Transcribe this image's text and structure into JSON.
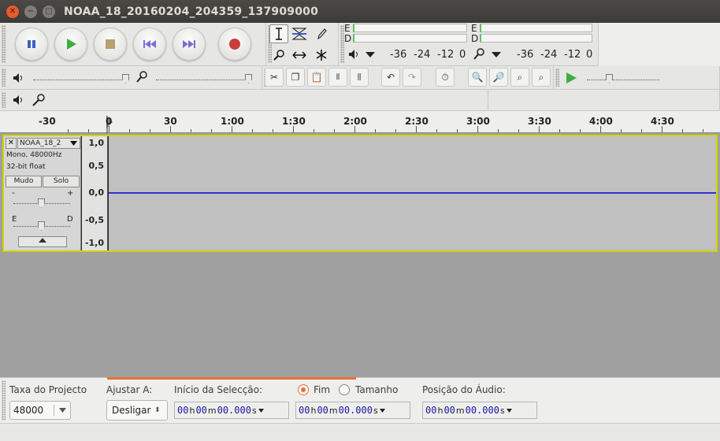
{
  "window": {
    "title": "NOAA_18_20160204_204359_137909000",
    "controls": [
      "close",
      "minimize",
      "maximize"
    ]
  },
  "transport": {
    "buttons": [
      "pause",
      "play",
      "stop",
      "skip-to-start",
      "skip-to-end",
      "record"
    ]
  },
  "tools": [
    "selection",
    "envelope",
    "draw",
    "zoom",
    "time-shift",
    "multi"
  ],
  "meters": {
    "playback_e": "E",
    "playback_d": "D",
    "record_e": "E",
    "record_d": "D",
    "scale_play": [
      "-36",
      "-24",
      "-12",
      "0"
    ],
    "scale_rec": [
      "-36",
      "-24",
      "-12",
      "0"
    ]
  },
  "ruler": {
    "labels": [
      "-30",
      "0",
      "30",
      "1:00",
      "1:30",
      "2:00",
      "2:30",
      "3:00",
      "3:30",
      "4:00",
      "4:30"
    ]
  },
  "track": {
    "name": "NOAA_18_2",
    "format": "Mono, 48000Hz",
    "bitdepth": "32-bit float",
    "mute_label": "Mudo",
    "solo_label": "Solo",
    "pan_left": "E",
    "pan_right": "D",
    "vscale": [
      "1,0",
      "0,5",
      "0,0",
      "-0,5",
      "-1,0"
    ]
  },
  "selection": {
    "rate_label": "Taxa do Projecto",
    "rate_value": "48000",
    "snap_label": "Ajustar A:",
    "snap_value": "Desligar",
    "start_label": "Início da Selecção:",
    "end_label": "Fim",
    "length_label": "Tamanho",
    "position_label": "Posição do Áudio:",
    "start_time": {
      "h": "00",
      "m": "00",
      "s": "00.000"
    },
    "end_time": {
      "h": "00",
      "m": "00",
      "s": "00.000"
    },
    "audio_pos": {
      "h": "00",
      "m": "00",
      "s": "00.000"
    },
    "unit_h": "h",
    "unit_m": "m",
    "unit_s": "s",
    "selected_radio": "Fim"
  },
  "colors": {
    "title_bg": "#3c3b37",
    "close_btn": "#e65a2e",
    "accent": "#e8703a",
    "waveform": "#3232c8",
    "track_select": "#d2d200"
  }
}
